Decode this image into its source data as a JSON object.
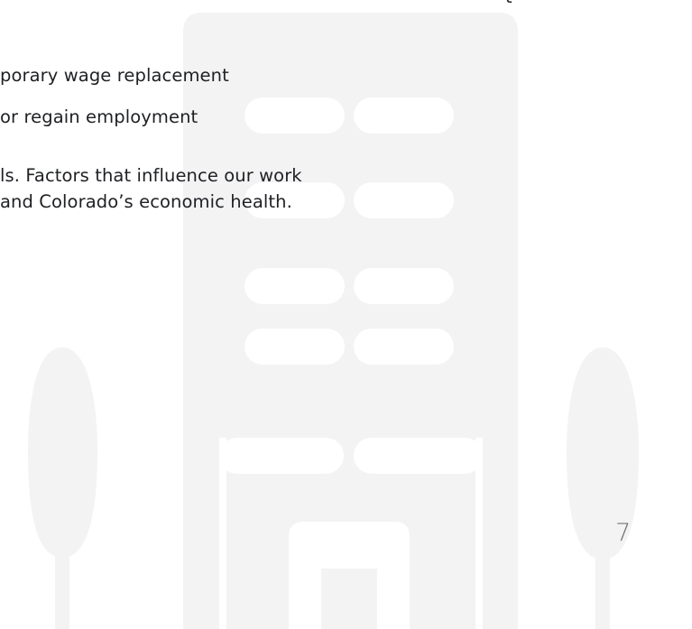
{
  "text_lines": [
    "t",
    "porary wage replacement",
    "or regain employment",
    "ls. Factors that influence our work",
    " and Colorado’s economic health."
  ],
  "page_number": "7",
  "colors": {
    "illustration_fill": "#f3f3f4",
    "illustration_detail": "#ffffff",
    "body_text": "#1e2023",
    "page_number_text": "#707375"
  }
}
